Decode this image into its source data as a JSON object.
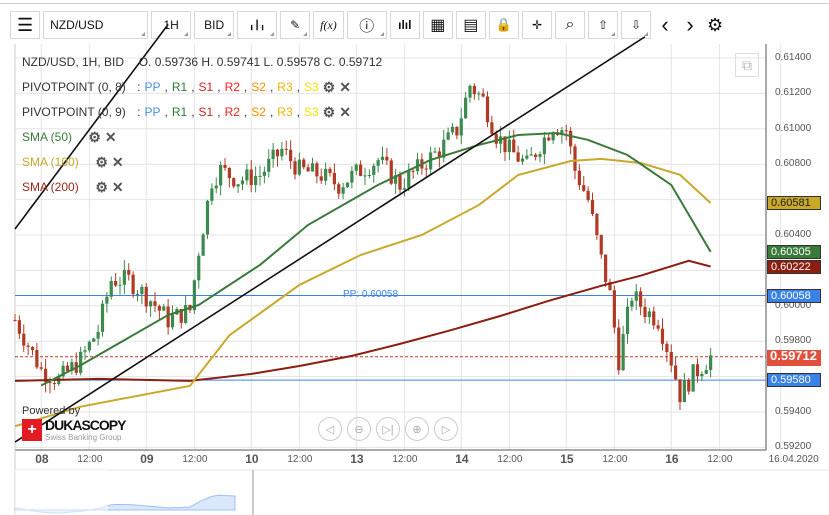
{
  "toolbar": {
    "menu": "☰",
    "symbol": "NZD/USD",
    "timeframe": "1H",
    "side": "BID",
    "candle": "╻┃╻",
    "draw": "✎",
    "fx": "f(x)",
    "info": "ⓘ",
    "bars": "ılıl",
    "calendar": "▦",
    "report": "▤",
    "lock": "🔒",
    "cursor": "✛",
    "zoom": "⌕",
    "upload": "⇧",
    "download": "⇩",
    "prev": "‹",
    "next": "›",
    "settings": "⚙"
  },
  "legend": {
    "title": "NZD/USD, 1H, BID",
    "ohlc": "O. 0.59736 H. 0.59741 L. 0.59578 C. 0.59712",
    "pivots": [
      {
        "label": "PIVOTPOINT (0, 8)"
      },
      {
        "label": "PIVOTPOINT (0, 9)"
      }
    ],
    "pivot_parts": [
      {
        "t": "PP",
        "c": "#4a90e2"
      },
      {
        "t": "R1",
        "c": "#2e7d32"
      },
      {
        "t": "S1",
        "c": "#c62828"
      },
      {
        "t": "R2",
        "c": "#ff2020"
      },
      {
        "t": "S2",
        "c": "#ff8c00"
      },
      {
        "t": "R3",
        "c": "#f0b400"
      },
      {
        "t": "S3",
        "c": "#f5e400"
      }
    ],
    "smas": [
      {
        "label": "SMA (50)",
        "color": "#3a7a3a"
      },
      {
        "label": "SMA (100)",
        "color": "#c9a82a"
      },
      {
        "label": "SMA (200)",
        "color": "#9a2a1a"
      }
    ]
  },
  "price_axis": {
    "ticks": [
      "0.61400",
      "0.61200",
      "0.61000",
      "0.60800",
      "0.60400",
      "0.60000",
      "0.59800",
      "0.59400",
      "0.59200"
    ],
    "labels": [
      {
        "text": "0.60581",
        "price": 0.60581,
        "bg": "#c9a82a",
        "fg": "#222"
      },
      {
        "text": "0.60305",
        "price": 0.60305,
        "bg": "#3a7a3a",
        "fg": "#fff"
      },
      {
        "text": "0.60222",
        "price": 0.60222,
        "bg": "#8b1e0e",
        "fg": "#fff"
      },
      {
        "text": "0.60058",
        "price": 0.60058,
        "bg": "#3b82e8",
        "fg": "#fff"
      },
      {
        "text": "0.59712",
        "price": 0.59712,
        "bg": "#e0503c",
        "fg": "#fff"
      },
      {
        "text": "0.59580",
        "price": 0.5958,
        "bg": "#3b82e8",
        "fg": "#fff"
      }
    ]
  },
  "time_axis": [
    {
      "t": "08",
      "bar": 6,
      "day": true
    },
    {
      "t": "12:00",
      "bar": 17
    },
    {
      "t": "09",
      "bar": 30,
      "day": true
    },
    {
      "t": "12:00",
      "bar": 41
    },
    {
      "t": "10",
      "bar": 54,
      "day": true
    },
    {
      "t": "12:00",
      "bar": 65
    },
    {
      "t": "13",
      "bar": 78,
      "day": true
    },
    {
      "t": "12:00",
      "bar": 89
    },
    {
      "t": "14",
      "bar": 102,
      "day": true
    },
    {
      "t": "12:00",
      "bar": 113
    },
    {
      "t": "15",
      "bar": 126,
      "day": true
    },
    {
      "t": "12:00",
      "bar": 137
    },
    {
      "t": "16",
      "bar": 150,
      "day": true
    },
    {
      "t": "12:00",
      "bar": 161
    },
    {
      "t": "16.04.2020",
      "bar": 175
    }
  ],
  "pp_label": "PP: 0.60058",
  "logo": {
    "powered": "Powered by",
    "brand": "DUKASCOPY",
    "sub": "Swiss Banking Group"
  },
  "nav": [
    "◁",
    "⊖",
    "▷|",
    "⊕",
    "▷"
  ],
  "chart_data": {
    "type": "candlestick",
    "ylim": [
      0.592,
      0.6148
    ],
    "close_points": [
      [
        0,
        0.5992
      ],
      [
        6,
        0.59637
      ],
      [
        10,
        0.59581
      ],
      [
        15,
        0.59694
      ],
      [
        19,
        0.59863
      ],
      [
        22,
        0.60146
      ],
      [
        26,
        0.60146
      ],
      [
        31,
        0.60033
      ],
      [
        35,
        0.5992
      ],
      [
        40,
        0.59976
      ],
      [
        42,
        0.60315
      ],
      [
        45,
        0.6071
      ],
      [
        47,
        0.60767
      ],
      [
        51,
        0.6071
      ],
      [
        56,
        0.60739
      ],
      [
        61,
        0.6088
      ],
      [
        65,
        0.60767
      ],
      [
        70,
        0.60739
      ],
      [
        74,
        0.60683
      ],
      [
        79,
        0.60767
      ],
      [
        83,
        0.60824
      ],
      [
        88,
        0.60683
      ],
      [
        93,
        0.60795
      ],
      [
        97,
        0.6088
      ],
      [
        101,
        0.60993
      ],
      [
        104,
        0.61247
      ],
      [
        107,
        0.61163
      ],
      [
        110,
        0.60965
      ],
      [
        113,
        0.6088
      ],
      [
        117,
        0.60795
      ],
      [
        120,
        0.6091
      ],
      [
        123,
        0.61021
      ],
      [
        126,
        0.60993
      ],
      [
        128,
        0.60767
      ],
      [
        131,
        0.60598
      ],
      [
        134,
        0.60259
      ],
      [
        136,
        0.60061
      ],
      [
        138,
        0.59694
      ],
      [
        141,
        0.60061
      ],
      [
        144,
        0.59976
      ],
      [
        147,
        0.5992
      ],
      [
        150,
        0.59694
      ],
      [
        152,
        0.595
      ],
      [
        155,
        0.5961
      ],
      [
        159,
        0.59712
      ]
    ],
    "sma50": [
      [
        6,
        0.5955
      ],
      [
        15,
        0.59664
      ],
      [
        35,
        0.59948
      ],
      [
        42,
        0.60005
      ],
      [
        56,
        0.60231
      ],
      [
        67,
        0.60457
      ],
      [
        83,
        0.60683
      ],
      [
        95,
        0.60824
      ],
      [
        106,
        0.60909
      ],
      [
        115,
        0.60965
      ],
      [
        124,
        0.60976
      ],
      [
        131,
        0.60937
      ],
      [
        140,
        0.60852
      ],
      [
        150,
        0.60683
      ],
      [
        159,
        0.60305
      ]
    ],
    "sma100": [
      [
        0,
        0.5932
      ],
      [
        15,
        0.5943
      ],
      [
        40,
        0.59548
      ],
      [
        49,
        0.59833
      ],
      [
        65,
        0.60118
      ],
      [
        79,
        0.60287
      ],
      [
        93,
        0.604
      ],
      [
        106,
        0.60569
      ],
      [
        115,
        0.60739
      ],
      [
        127,
        0.60818
      ],
      [
        134,
        0.6083
      ],
      [
        143,
        0.60807
      ],
      [
        152,
        0.6074
      ],
      [
        159,
        0.60581
      ]
    ],
    "sma200": [
      [
        0,
        0.59576
      ],
      [
        19,
        0.59587
      ],
      [
        40,
        0.59576
      ],
      [
        54,
        0.59615
      ],
      [
        65,
        0.5966
      ],
      [
        77,
        0.59717
      ],
      [
        88,
        0.59785
      ],
      [
        99,
        0.59858
      ],
      [
        111,
        0.59943
      ],
      [
        122,
        0.60028
      ],
      [
        134,
        0.60113
      ],
      [
        143,
        0.6017
      ],
      [
        154,
        0.60254
      ],
      [
        159,
        0.60222
      ]
    ],
    "trendlines": [
      {
        "from": [
          0,
          0.60434
        ],
        "to": [
          35,
          0.6159
        ]
      },
      {
        "from": [
          0,
          0.5923
        ],
        "to": [
          144,
          0.6152
        ]
      }
    ],
    "hlines": [
      {
        "price": 0.60058,
        "color": "#3b82e8",
        "style": "solid"
      },
      {
        "price": 0.5958,
        "color": "#3b82e8",
        "style": "solid"
      },
      {
        "price": 0.59712,
        "color": "#c0392b",
        "style": "dashed"
      }
    ]
  }
}
